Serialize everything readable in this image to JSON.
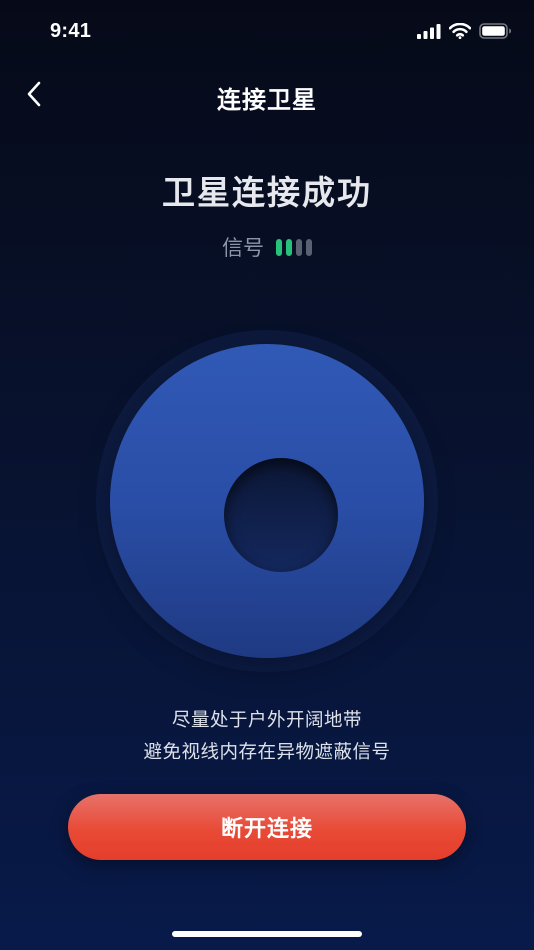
{
  "status_bar": {
    "time": "9:41",
    "icons": [
      "cellular-icon",
      "wifi-icon",
      "battery-icon"
    ]
  },
  "nav": {
    "title": "连接卫星",
    "back_icon": "chevron-left-icon"
  },
  "main": {
    "status_title": "卫星连接成功",
    "signal_label": "信号",
    "signal_level": 2,
    "signal_max": 4,
    "hint_lines": [
      "尽量处于户外开阔地带",
      "避免视线内存在异物遮蔽信号"
    ]
  },
  "actions": {
    "disconnect_label": "断开连接"
  },
  "colors": {
    "signal_active": "#27c27a",
    "signal_inactive": "#5a6172",
    "disc": "#2a4ea7",
    "button": "#e84a36",
    "background": "#060a18"
  }
}
